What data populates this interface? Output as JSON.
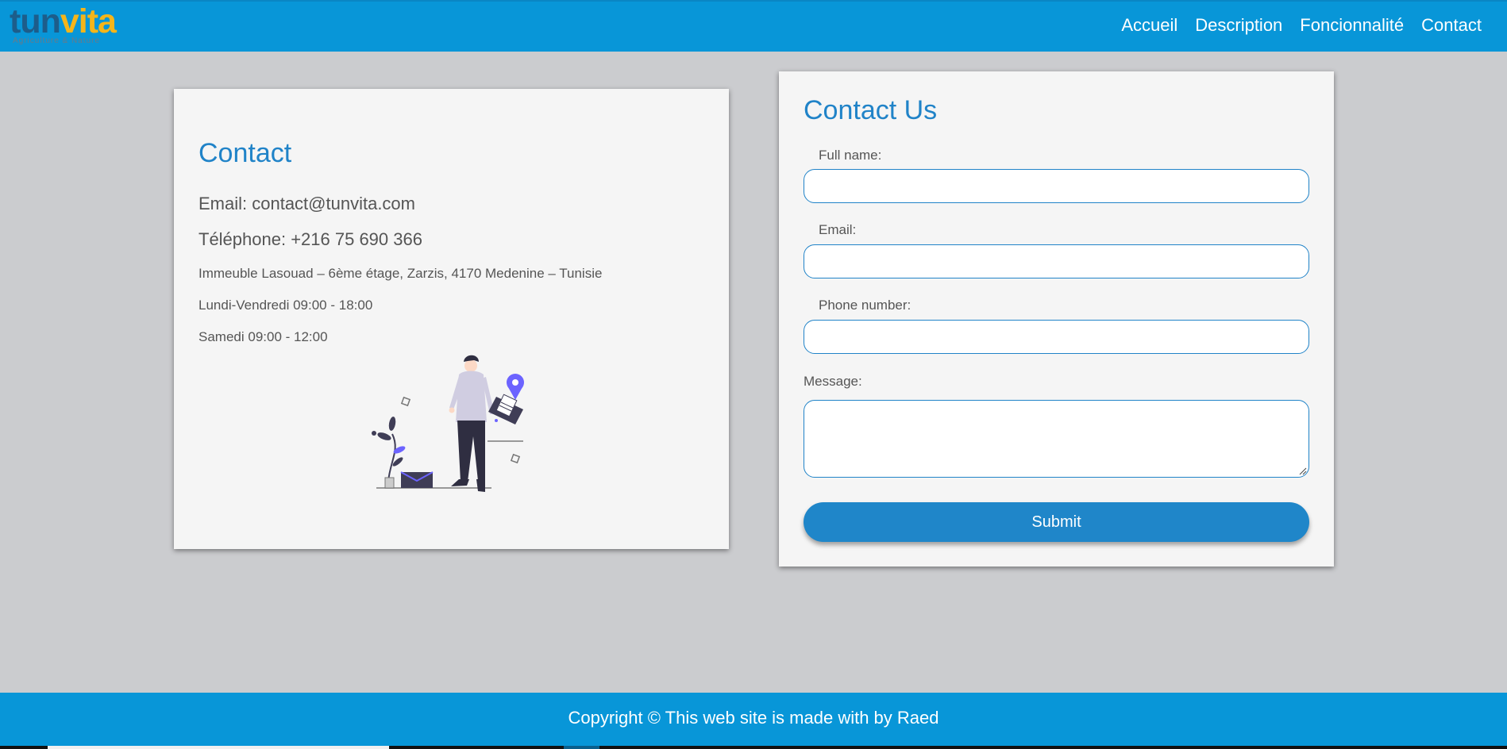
{
  "header": {
    "logo_text_part1": "tun",
    "logo_text_part2": "vita",
    "logo_tagline": "Agriculture & Nature",
    "nav": [
      "Accueil",
      "Description",
      "Foncionnalité",
      "Contact"
    ]
  },
  "contact": {
    "title": "Contact",
    "email": "Email: contact@tunvita.com",
    "phone": "Téléphone: +216 75 690 366",
    "address": "Immeuble Lasouad – 6ème étage, Zarzis, 4170 Medenine – Tunisie",
    "hours_week": "Lundi-Vendredi 09:00 - 18:00",
    "hours_sat": "Samedi 09:00 - 12:00"
  },
  "form": {
    "title": "Contact Us",
    "fullname_label": "Full name:",
    "email_label": "Email:",
    "phone_label": "Phone number:",
    "message_label": "Message:",
    "fullname_value": "",
    "email_value": "",
    "phone_value": "",
    "message_value": "",
    "submit_label": "Submit"
  },
  "footer": {
    "text": "Copyright © This web site is made with by Raed"
  },
  "colors": {
    "header_bg": "#0896d8",
    "accent": "#2083c8",
    "page_bg": "#cbcccf",
    "card_bg": "#f5f5f5",
    "logo_amber": "#f5b51a",
    "logo_dark": "#1d5d8a"
  }
}
